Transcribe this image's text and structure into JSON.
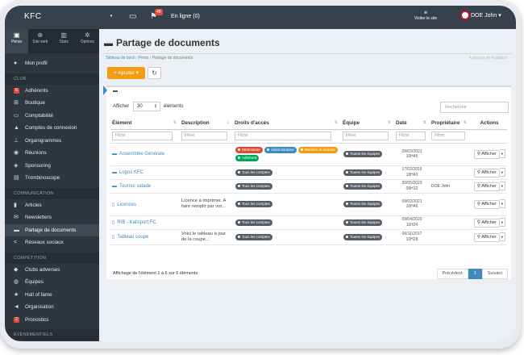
{
  "topbar": {
    "brand": "KFC",
    "notif_count": "48",
    "online": "En ligne (0)",
    "visit_site": "Visiter le site",
    "user": "DOE John"
  },
  "sidebar": {
    "tabs": [
      {
        "label": "Perso",
        "icon": "user-icon"
      },
      {
        "label": "Site web",
        "icon": "globe-icon"
      },
      {
        "label": "Stats",
        "icon": "chart-icon"
      },
      {
        "label": "Options",
        "icon": "gears-icon"
      }
    ],
    "profile": "Mon profil",
    "sections": [
      {
        "title": "CLUB",
        "items": [
          {
            "label": "Adhérents",
            "icon": "number-badge",
            "badge": "6"
          },
          {
            "label": "Boutique",
            "icon": "cart-icon"
          },
          {
            "label": "Comptabilité",
            "icon": "money-icon"
          },
          {
            "label": "Comptes de connexion",
            "icon": "lock-icon"
          },
          {
            "label": "Organigrammes",
            "icon": "sitemap-icon"
          },
          {
            "label": "Réunions",
            "icon": "users-icon"
          },
          {
            "label": "Sponsoring",
            "icon": "sponsor-icon"
          },
          {
            "label": "Trombinoscope",
            "icon": "id-card-icon"
          }
        ]
      },
      {
        "title": "COMMUNICATION",
        "items": [
          {
            "label": "Articles",
            "icon": "bookmark-icon"
          },
          {
            "label": "Newsletters",
            "icon": "envelope-icon"
          },
          {
            "label": "Partage de documents",
            "icon": "folder-icon",
            "active": true
          },
          {
            "label": "Réseaux sociaux",
            "icon": "share-icon"
          }
        ]
      },
      {
        "title": "COMPÉTITION",
        "items": [
          {
            "label": "Clubs adverses",
            "icon": "shield-icon"
          },
          {
            "label": "Équipes",
            "icon": "team-icon"
          },
          {
            "label": "Hall of fame",
            "icon": "star-icon"
          },
          {
            "label": "Organisation",
            "icon": "bullhorn-icon"
          },
          {
            "label": "Pronostics",
            "icon": "number-badge",
            "badge": "2"
          }
        ]
      },
      {
        "title": "ÉVÉNEMENTIELS",
        "items": []
      }
    ]
  },
  "page": {
    "title": "Partage de documents",
    "breadcrumb": [
      "Tableau de bord",
      "Perso",
      "Partage de documents"
    ],
    "breadcrumb_right": "A propos de Kalisport",
    "add_button": "+ Ajouter",
    "show_label": "Afficher",
    "show_value": "30",
    "show_suffix": "éléments",
    "search_placeholder": "Recherche",
    "filter_placeholder": "Filtrer",
    "columns": [
      "Élément",
      "Description",
      "Droits d'accès",
      "Équipe",
      "Date",
      "Propriétaire",
      "Actions"
    ],
    "rows": [
      {
        "element": "Assemblée Générale",
        "icon": "folder-icon",
        "description": "",
        "access": [
          {
            "text": "Webmaster",
            "color": "#dd4b39"
          },
          {
            "text": "Administrateur",
            "color": "#3c8dbc"
          },
          {
            "text": "Membre du bureau",
            "color": "#f39c12"
          },
          {
            "text": "Adhérent",
            "color": "#00a65a"
          }
        ],
        "team": "Toutes les équipes",
        "date": "09/02/2021",
        "time": "10H45",
        "owner": ""
      },
      {
        "element": "Logos KFC",
        "icon": "folder-icon",
        "description": "",
        "access": [
          {
            "text": "Tous les comptes",
            "color": "#555d66"
          }
        ],
        "team": "Toutes les équipes",
        "date": "17/02/2016",
        "time": "18H43",
        "owner": ""
      },
      {
        "element": "Tournoi salade",
        "icon": "folder-icon",
        "description": "",
        "access": [
          {
            "text": "Tous les comptes",
            "color": "#555d66"
          }
        ],
        "team": "Toutes les équipes",
        "date": "30/05/2023",
        "time": "09H12",
        "owner": "DOE John"
      },
      {
        "element": "Licences",
        "icon": "file-icon",
        "description": "Licence à imprimer. A faire remplir par vot...",
        "access": [
          {
            "text": "Tous les comptes",
            "color": "#555d66"
          }
        ],
        "team": "Toutes les équipes",
        "date": "09/02/2021",
        "time": "10H46",
        "owner": ""
      },
      {
        "element": "RIB - Kalisport FC",
        "icon": "file-icon",
        "description": "",
        "access": [
          {
            "text": "Tous les comptes",
            "color": "#555d66"
          }
        ],
        "team": "Toutes les équipes",
        "date": "09/04/2020",
        "time": "11H24",
        "owner": ""
      },
      {
        "element": "Tableau coupe",
        "icon": "file-icon",
        "description": "Voici le tableau à jour de la coupe...",
        "access": [
          {
            "text": "Tous les comptes",
            "color": "#555d66"
          }
        ],
        "team": "Toutes les équipes",
        "date": "06/11/2017",
        "time": "10H28",
        "owner": ""
      }
    ],
    "action_label": "Afficher",
    "footer_info": "Affichage de l'élément 1 à 6 sur 6 éléments",
    "pager": {
      "prev": "Précédent",
      "current": "1",
      "next": "Suivant"
    }
  }
}
